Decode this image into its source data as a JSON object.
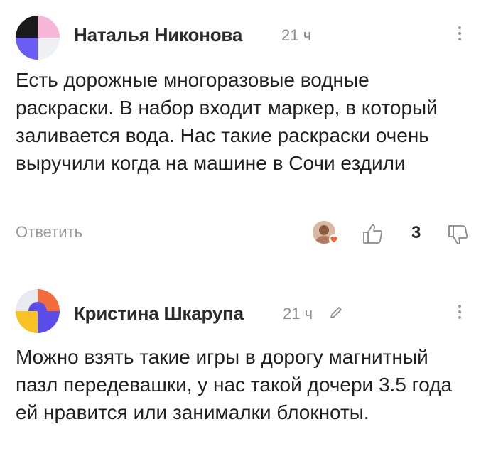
{
  "comments": [
    {
      "author": "Наталья Никонова",
      "time": "21 ч",
      "text": "Есть дорожные многоразовые водные раскраски. В набор входит маркер, в который заливается вода. Нас такие раскраски очень выручили когда на машине в Сочи ездили",
      "reply_label": "Ответить",
      "like_count": "3",
      "icons": [
        "avatar",
        "more-vertical-icon",
        "liker-avatar",
        "heart-icon",
        "thumbs-up-icon",
        "thumbs-down-icon"
      ]
    },
    {
      "author": "Кристина Шкарупа",
      "time": "21 ч",
      "text": "Можно взять такие игры в дорогу магнитный пазл передевашки, у нас такой дочери 3.5 года ей нравится или занималки блокноты.",
      "icons": [
        "avatar",
        "pencil-icon",
        "more-vertical-icon"
      ]
    }
  ],
  "colors": {
    "name": "#2b2b2b",
    "meta": "#8a8a8a",
    "heart": "#f0642f",
    "avatar1": [
      "#1a1a1a",
      "#f7b6d8",
      "#6b5cf6",
      "#eef0f4"
    ],
    "avatar2": [
      "#f9c423",
      "#5b4de8",
      "#f26b3a",
      "#e9eaf0"
    ]
  }
}
